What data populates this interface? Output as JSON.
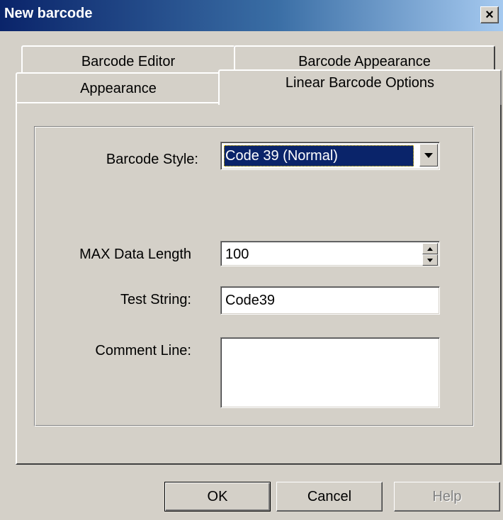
{
  "window": {
    "title": "New barcode",
    "close_symbol": "×"
  },
  "tabs": {
    "row_back": [
      {
        "label": "Barcode Editor"
      },
      {
        "label": "Barcode Appearance"
      }
    ],
    "row_front": [
      {
        "label": "Appearance"
      },
      {
        "label": "Linear Barcode Options",
        "active": true
      }
    ]
  },
  "form": {
    "barcode_style": {
      "label": "Barcode Style:",
      "value": "Code 39 (Normal)"
    },
    "max_data_length": {
      "label": "MAX Data Length",
      "value": "100"
    },
    "test_string": {
      "label": "Test String:",
      "value": "Code39"
    },
    "comment_line": {
      "label": "Comment Line:",
      "value": ""
    }
  },
  "buttons": {
    "ok": "OK",
    "cancel": "Cancel",
    "help": "Help",
    "help_enabled": false
  },
  "colors": {
    "titlebar_start": "#0a246a",
    "titlebar_end": "#a6caf0",
    "dialog_bg": "#d4d0c8",
    "selection": "#0a246a"
  }
}
